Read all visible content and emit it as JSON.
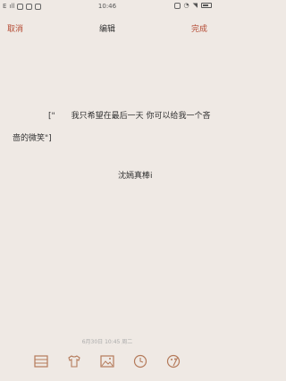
{
  "status": {
    "network": "E",
    "signal": "ıll",
    "time": "10:46",
    "battery_level": 0.5
  },
  "header": {
    "cancel": "取消",
    "title": "编辑",
    "done": "完成"
  },
  "content": {
    "text": "[\"　　我只希望在最后一天 你可以给我一个吝啬的微笑\"]",
    "signature": "沈嫣真棒i"
  },
  "footer": {
    "date": "6月30日 10:45 周二"
  },
  "toolbar": {
    "icons": [
      "list-icon",
      "shirt-icon",
      "image-icon",
      "clock-icon",
      "palette-icon"
    ]
  },
  "colors": {
    "accent": "#b44a33",
    "background": "#efe9e4"
  }
}
